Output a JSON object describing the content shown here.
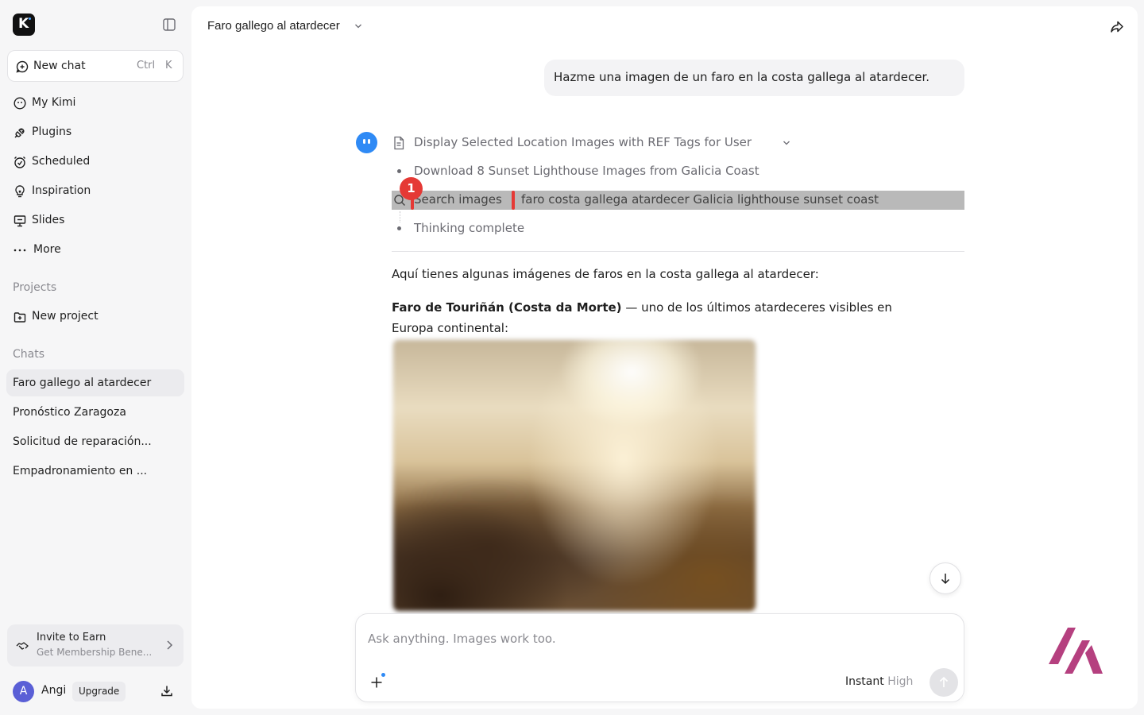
{
  "sidebar": {
    "new_chat_label": "New chat",
    "shortcut_ctrl": "Ctrl",
    "shortcut_k": "K",
    "nav": [
      {
        "label": "My Kimi",
        "icon": "kimi-face-icon"
      },
      {
        "label": "Plugins",
        "icon": "plug-icon"
      },
      {
        "label": "Scheduled",
        "icon": "alarm-clock-icon"
      },
      {
        "label": "Inspiration",
        "icon": "lightbulb-icon"
      },
      {
        "label": "Slides",
        "icon": "presentation-icon"
      },
      {
        "label": "More",
        "icon": "more-dots-icon"
      }
    ],
    "projects_label": "Projects",
    "new_project_label": "New project",
    "chats_label": "Chats",
    "chats": [
      "Faro gallego al atardecer",
      "Pronóstico Zaragoza",
      "Solicitud de reparación...",
      "Empadronamiento en ..."
    ],
    "invite_title": "Invite to Earn",
    "invite_subtitle": "Get Membership Bene...",
    "user_initial": "A",
    "user_name": "Angi",
    "upgrade_label": "Upgrade"
  },
  "header": {
    "title": "Faro gallego al atardecer"
  },
  "conversation": {
    "user_message": "Hazme una imagen de un faro en la costa gallega al atardecer.",
    "steps_title": "Display Selected Location Images with REF Tags for User",
    "step_download": "Download 8 Sunset Lighthouse Images from Galicia Coast",
    "search_label": "Search images",
    "search_query": "faro costa gallega atardecer Galicia lighthouse sunset coast",
    "step_done": "Thinking complete",
    "annotation_badge": "1",
    "intro": "Aquí tienes algunas imágenes de faros en la costa gallega al atardecer:",
    "item_title": "Faro de Touriñán (Costa da Morte)",
    "item_desc_line1": " — uno de los últimos atardeceres visibles en",
    "item_desc_line2": "Europa continental:"
  },
  "composer": {
    "placeholder": "Ask anything. Images work too.",
    "mode": "Instant",
    "level": "High"
  },
  "colors": {
    "accent_blue": "#2f8af5",
    "annotation_red": "#e53935",
    "brand_magenta": "#b5407f"
  }
}
